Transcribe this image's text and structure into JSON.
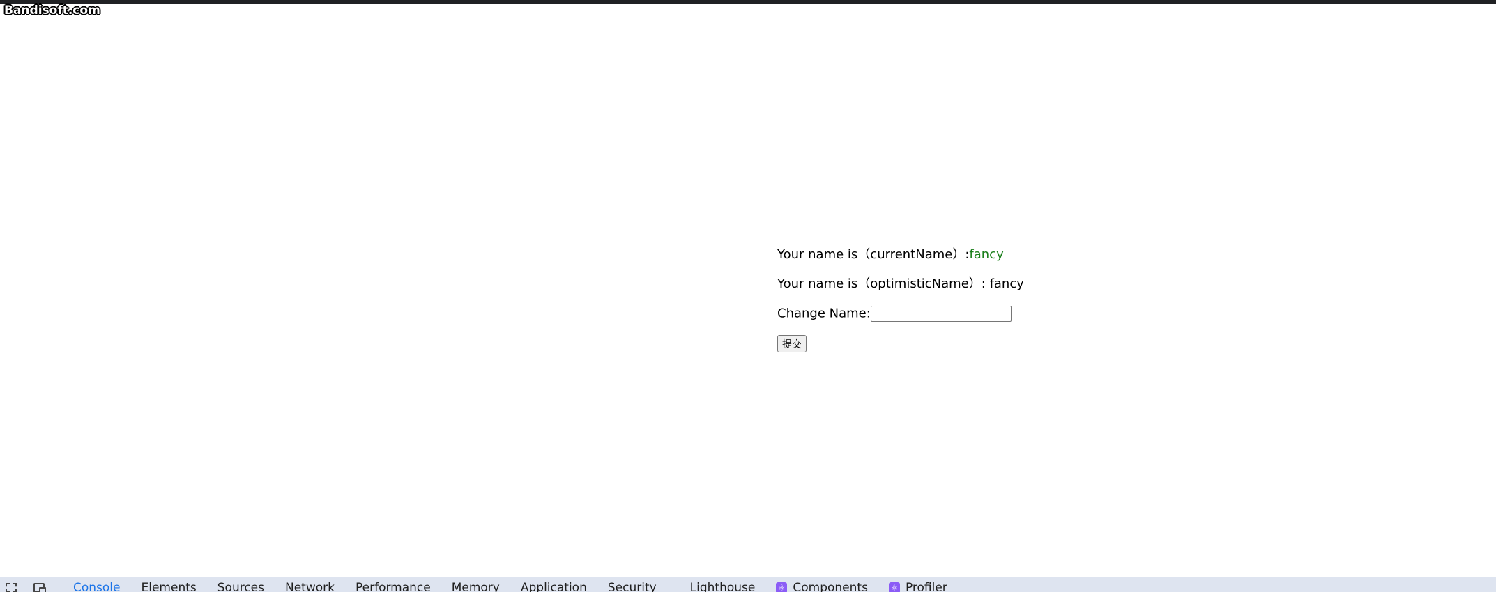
{
  "watermark": "Bandisoft.com",
  "app": {
    "current_label": "Your name is（currentName）:",
    "current_value": "fancy",
    "optimistic_label": "Your name is（optimisticName）: ",
    "optimistic_value": "fancy",
    "change_label": "Change Name:",
    "input_value": "",
    "submit_label": "提交"
  },
  "devtools": {
    "tabs": [
      {
        "label": "Console"
      },
      {
        "label": "Elements"
      },
      {
        "label": "Sources"
      },
      {
        "label": "Network"
      },
      {
        "label": "Performance"
      },
      {
        "label": "Memory"
      },
      {
        "label": "Application"
      },
      {
        "label": "Security"
      },
      {
        "label": "Lighthouse"
      },
      {
        "label": "Components"
      },
      {
        "label": "Profiler"
      }
    ],
    "active_tab": "Console",
    "accent_color": "#1a73e8",
    "react_icon_color": "#8b5cf6"
  },
  "colors": {
    "current_name_value": "#1a7f1a"
  }
}
